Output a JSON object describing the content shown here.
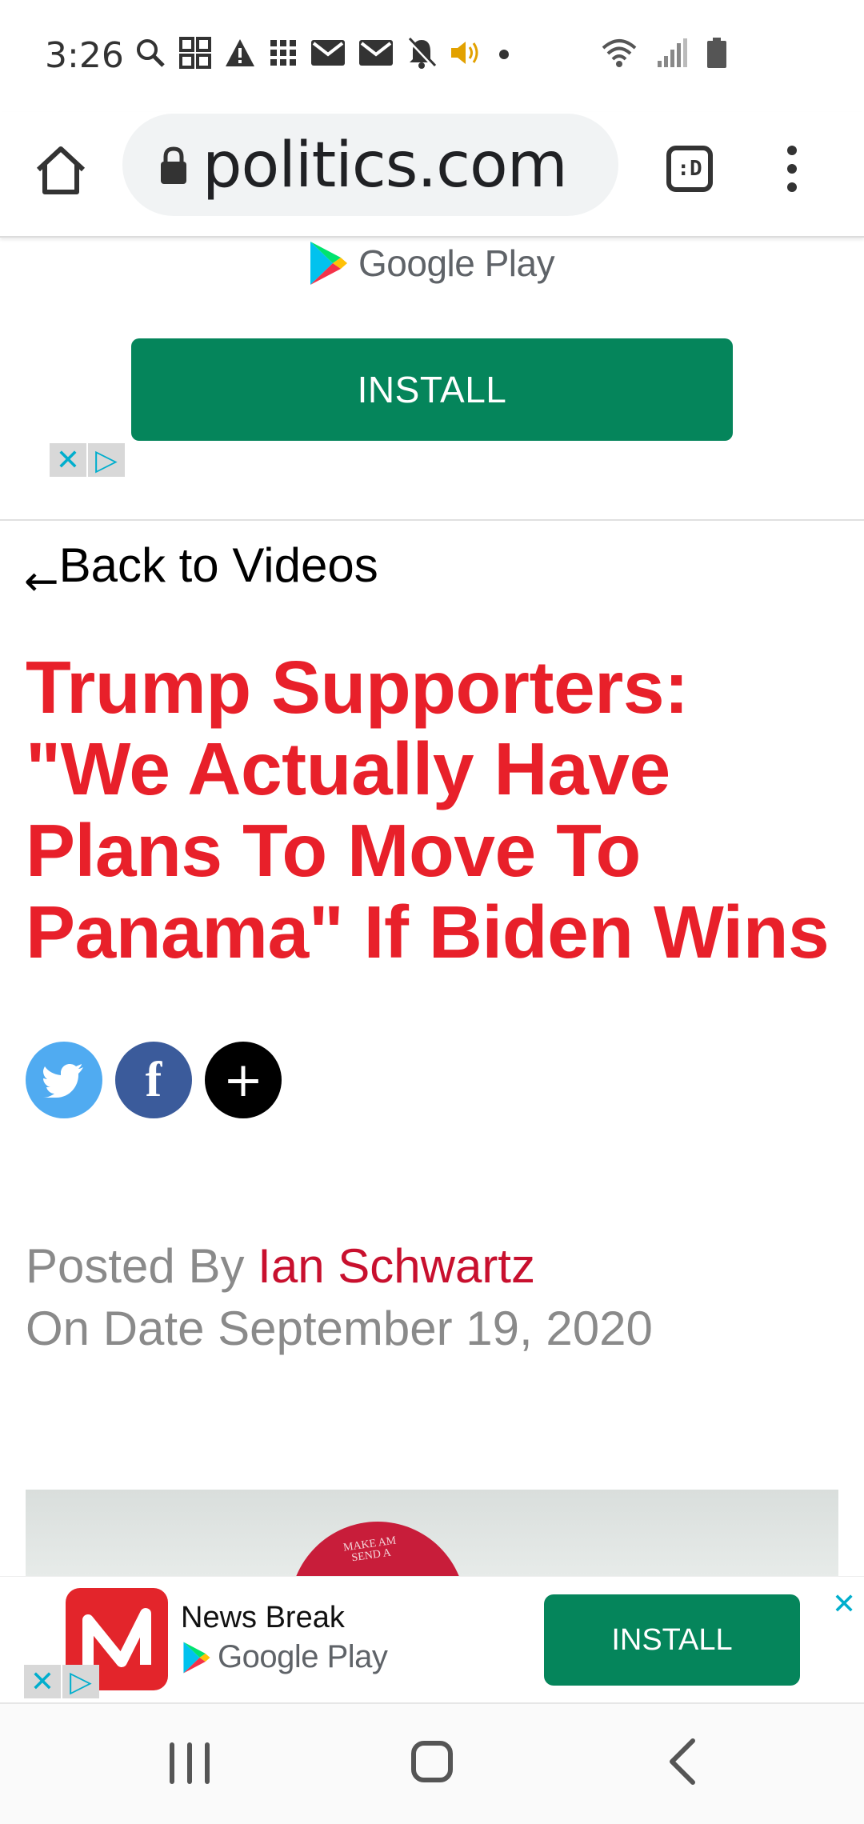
{
  "status_bar": {
    "time": "3:26",
    "left_icons": [
      "search-icon",
      "qr-icon",
      "warning-icon",
      "grid-icon",
      "mail-icon",
      "mail-icon",
      "bell-off-icon",
      "volume-icon",
      "dot-icon"
    ],
    "right_icons": [
      "wifi-icon",
      "signal-icon",
      "battery-icon"
    ]
  },
  "browser": {
    "url": "politics.com",
    "tabs_label": ":D"
  },
  "top_ad": {
    "store_label": "Google Play",
    "install_label": "INSTALL",
    "close_glyph": "✕",
    "adchoices_glyph": "▷"
  },
  "article": {
    "back_arrow": "←",
    "back_label": "Back to Videos",
    "headline": "Trump Supporters: \"We Actually Have Plans To Move To Panama\" If Biden Wins",
    "share": {
      "facebook_glyph": "f",
      "more_glyph": "+"
    },
    "posted_by_prefix": "Posted By ",
    "author": "Ian Schwartz",
    "date_line": "On Date September 19, 2020",
    "thumb_hat_text": "MAKE AM\nSEND A"
  },
  "bottom_ad": {
    "app_name": "News Break",
    "store_label": "Google Play",
    "install_label": "INSTALL",
    "close_glyph": "✕",
    "adchoices_glyph": "▷"
  },
  "colors": {
    "headline_red": "#e8202a",
    "author_red": "#c8102e",
    "install_green": "#05855b",
    "twitter_blue": "#50abf1",
    "facebook_blue": "#3b5b9b"
  }
}
